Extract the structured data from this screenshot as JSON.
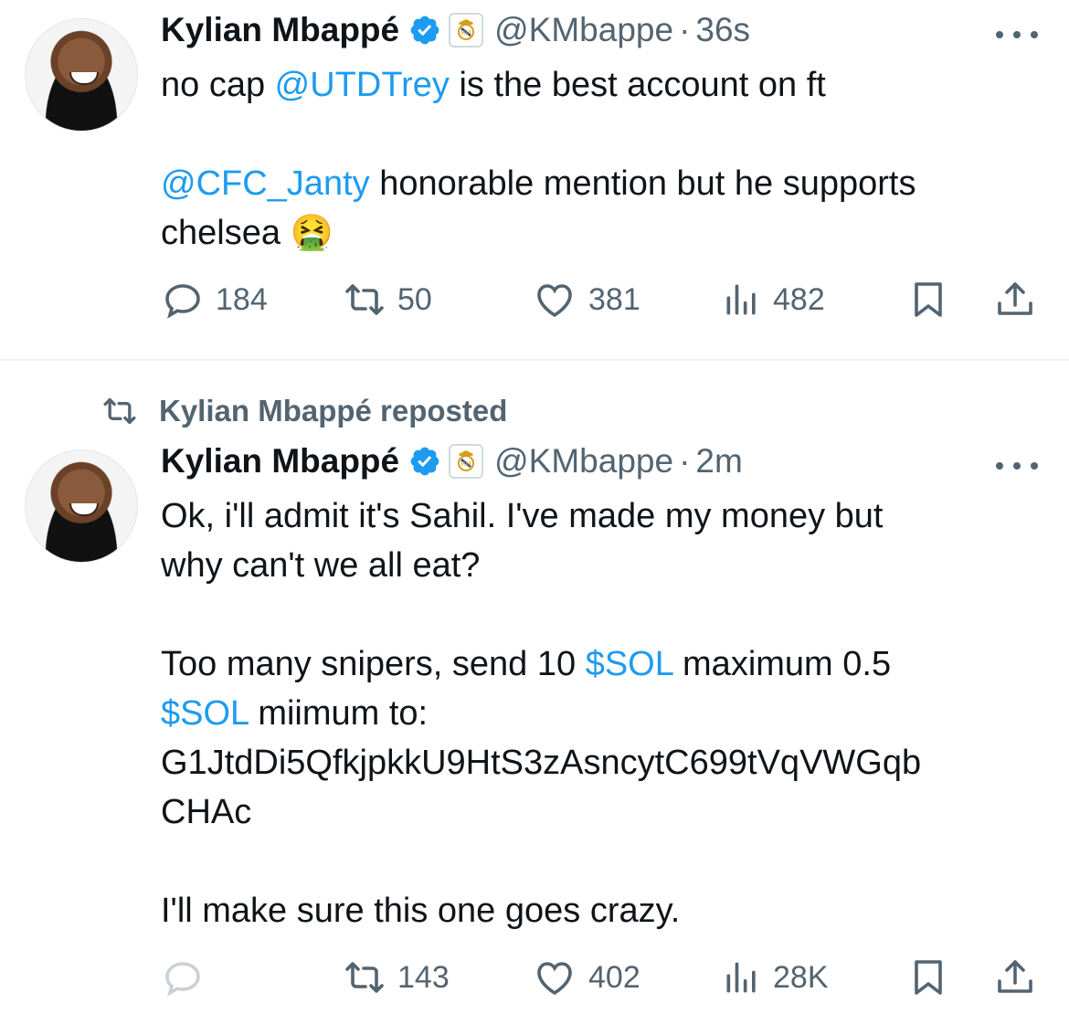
{
  "tweets": [
    {
      "author_name": "Kylian Mbappé",
      "handle": "@KMbappe",
      "separator": "·",
      "time": "36s",
      "text": {
        "l1_a": "no cap ",
        "l1_link": "@UTDTrey",
        "l1_b": " is the best account on ft",
        "l2_link": "@CFC_Janty",
        "l2_b": " honorable mention but he supports",
        "l3": "chelsea ",
        "emoji": "🤮"
      },
      "stats": {
        "replies": "184",
        "reposts": "50",
        "likes": "381",
        "views": "482"
      }
    },
    {
      "repost_label": "Kylian Mbappé reposted",
      "author_name": "Kylian Mbappé",
      "handle": "@KMbappe",
      "separator": "·",
      "time": "2m",
      "text": {
        "l1": "Ok, i'll admit it's Sahil. I've made my money but",
        "l2": "why can't we all eat?",
        "l3_a": "Too many snipers, send 10 ",
        "l3_link": "$SOL",
        "l3_b": " maximum 0.5",
        "l4_link": "$SOL",
        "l4_b": " miimum to:",
        "l5": "G1JtdDi5QfkjpkkU9HtS3zAsncytC699tVqVWGqb",
        "l6": "CHAc",
        "l7": "I'll make sure this one goes crazy."
      },
      "stats": {
        "reposts": "143",
        "likes": "402",
        "views": "28K"
      }
    }
  ],
  "colors": {
    "link": "#1d9bf0",
    "secondary_text": "#536471",
    "verified": "#1d9bf0",
    "divider": "#eff3f4"
  },
  "icons": [
    "reply-icon",
    "repost-icon",
    "like-icon",
    "views-icon",
    "bookmark-icon",
    "share-icon",
    "verified-badge-icon",
    "real-madrid-badge-icon",
    "more-icon"
  ]
}
